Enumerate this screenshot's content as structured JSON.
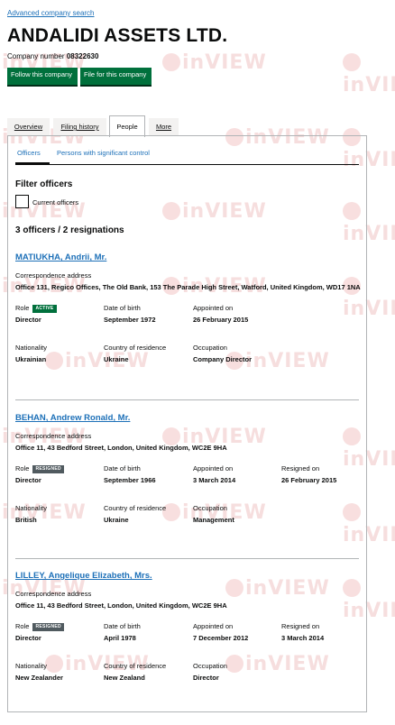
{
  "header": {
    "advanced_search_link": "Advanced company search",
    "company_name": "ANDALIDI ASSETS LTD.",
    "company_number_label": "Company number",
    "company_number": "08322630",
    "follow_button": "Follow this company",
    "file_button": "File for this company"
  },
  "tabs": [
    {
      "label": "Overview"
    },
    {
      "label": "Filing history"
    },
    {
      "label": "People",
      "active": true
    },
    {
      "label": "More"
    }
  ],
  "subnav": {
    "officers": "Officers",
    "psc": "Persons with significant control"
  },
  "filter": {
    "title": "Filter officers",
    "checkbox_label": "Current officers",
    "checked": false
  },
  "summary": "3 officers / 2 resignations",
  "labels": {
    "correspondence_address": "Correspondence address",
    "role": "Role",
    "date_of_birth": "Date of birth",
    "appointed_on": "Appointed on",
    "resigned_on": "Resigned on",
    "nationality": "Nationality",
    "country_of_residence": "Country of residence",
    "occupation": "Occupation"
  },
  "officers": [
    {
      "name": "MATIUKHA, Andrii, Mr.",
      "address": "Office 131, Regico Offices, The Old Bank, 153 The Parade High Street, Watford, United Kingdom, WD17 1NA",
      "role": "Director",
      "status": "ACTIVE",
      "date_of_birth": "September 1972",
      "appointed_on": "26 February 2015",
      "nationality": "Ukrainian",
      "country_of_residence": "Ukraine",
      "occupation": "Company Director"
    },
    {
      "name": "BEHAN, Andrew Ronald, Mr.",
      "address": "Office 11, 43 Bedford Street, London, United Kingdom, WC2E 9HA",
      "role": "Director",
      "status": "RESIGNED",
      "date_of_birth": "September 1966",
      "appointed_on": "3 March 2014",
      "resigned_on": "26 February 2015",
      "nationality": "British",
      "country_of_residence": "Ukraine",
      "occupation": "Management"
    },
    {
      "name": "LILLEY, Angelique Elizabeth, Mrs.",
      "address": "Office 11, 43 Bedford Street, London, United Kingdom, WC2E 9HA",
      "role": "Director",
      "status": "RESIGNED",
      "date_of_birth": "April 1978",
      "appointed_on": "7 December 2012",
      "resigned_on": "3 March 2014",
      "nationality": "New Zealander",
      "country_of_residence": "New Zealand",
      "occupation": "Director"
    }
  ],
  "watermark": "inVIEW",
  "colors": {
    "link": "#1d70b8",
    "button_green": "#00703c",
    "badge_active": "#00703c",
    "badge_resigned": "#505a5f",
    "watermark": "#f0c4c4"
  }
}
